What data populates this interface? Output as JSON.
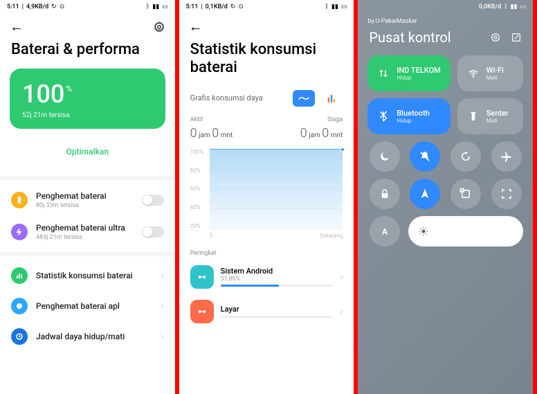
{
  "phone1": {
    "status": {
      "time": "5:11",
      "speed": "4,9KB/d"
    },
    "title": "Baterai & performa",
    "battery_percent": "100",
    "battery_symbol": "%",
    "battery_remaining": "52j 21m tersisa",
    "optimize": "Optimalkan",
    "rows": [
      {
        "title": "Penghemat baterai",
        "sub": "80j 33m tersisa"
      },
      {
        "title": "Penghemat baterai ultra",
        "sub": "483j 21m tersisa"
      }
    ],
    "links": [
      {
        "title": "Statistik konsumsi baterai"
      },
      {
        "title": "Penghemat baterai apl"
      },
      {
        "title": "Jadwal daya hidup/mati"
      }
    ]
  },
  "phone2": {
    "status": {
      "time": "5:11",
      "speed": "0,1KB/d"
    },
    "title": "Statistik konsumsi baterai",
    "chart_toggle_label": "Grafis konsumsi daya",
    "meta_left": "Aktif",
    "meta_right": "Siaga",
    "active_h": "0",
    "active_h_unit": "jam",
    "active_m": "0",
    "active_m_unit": "mnt",
    "idle_h": "0",
    "idle_h_unit": "jam",
    "idle_m": "0",
    "idle_m_unit": "mnt",
    "y_labels": [
      "100%",
      "80%",
      "60%",
      "40%",
      "20%"
    ],
    "x_left": "5",
    "x_right": "Sekarang",
    "rank_label": "Peringkat",
    "apps": [
      {
        "name": "Sistem Android",
        "pct": "51,86%",
        "pct_num": 51.86,
        "color": "#2ec3c9"
      },
      {
        "name": "Layar",
        "pct": "",
        "pct_num": 0,
        "color": "#ff6b4a"
      }
    ]
  },
  "phone3": {
    "status": {
      "speed": "0,0KB/d"
    },
    "brand": "by.U-PakaiMasker",
    "title": "Pusat kontrol",
    "tiles": [
      {
        "label": "IND TELKOM",
        "sub": "Hidup",
        "icon": "data",
        "state": "green"
      },
      {
        "label": "Wi-Fi",
        "sub": "Mati",
        "icon": "wifi",
        "state": "off"
      },
      {
        "label": "Bluetooth",
        "sub": "Hidup",
        "icon": "bt",
        "state": "blue"
      },
      {
        "label": "Senter",
        "sub": "Mati",
        "icon": "torch",
        "state": "off"
      }
    ],
    "minis": [
      {
        "icon": "moon",
        "state": "off"
      },
      {
        "icon": "mute",
        "state": "on"
      },
      {
        "icon": "rotate",
        "state": "off"
      },
      {
        "icon": "plane",
        "state": "off"
      },
      {
        "icon": "lock",
        "state": "off"
      },
      {
        "icon": "location",
        "state": "on"
      },
      {
        "icon": "screenshot",
        "state": "off"
      },
      {
        "icon": "scan",
        "state": "off"
      },
      {
        "icon": "font",
        "state": "off"
      }
    ]
  },
  "chart_data": {
    "type": "line",
    "title": "Grafis konsumsi daya",
    "ylabel": "%",
    "ylim": [
      0,
      100
    ],
    "x": [
      "5",
      "Sekarang"
    ],
    "values": [
      100,
      100
    ]
  }
}
